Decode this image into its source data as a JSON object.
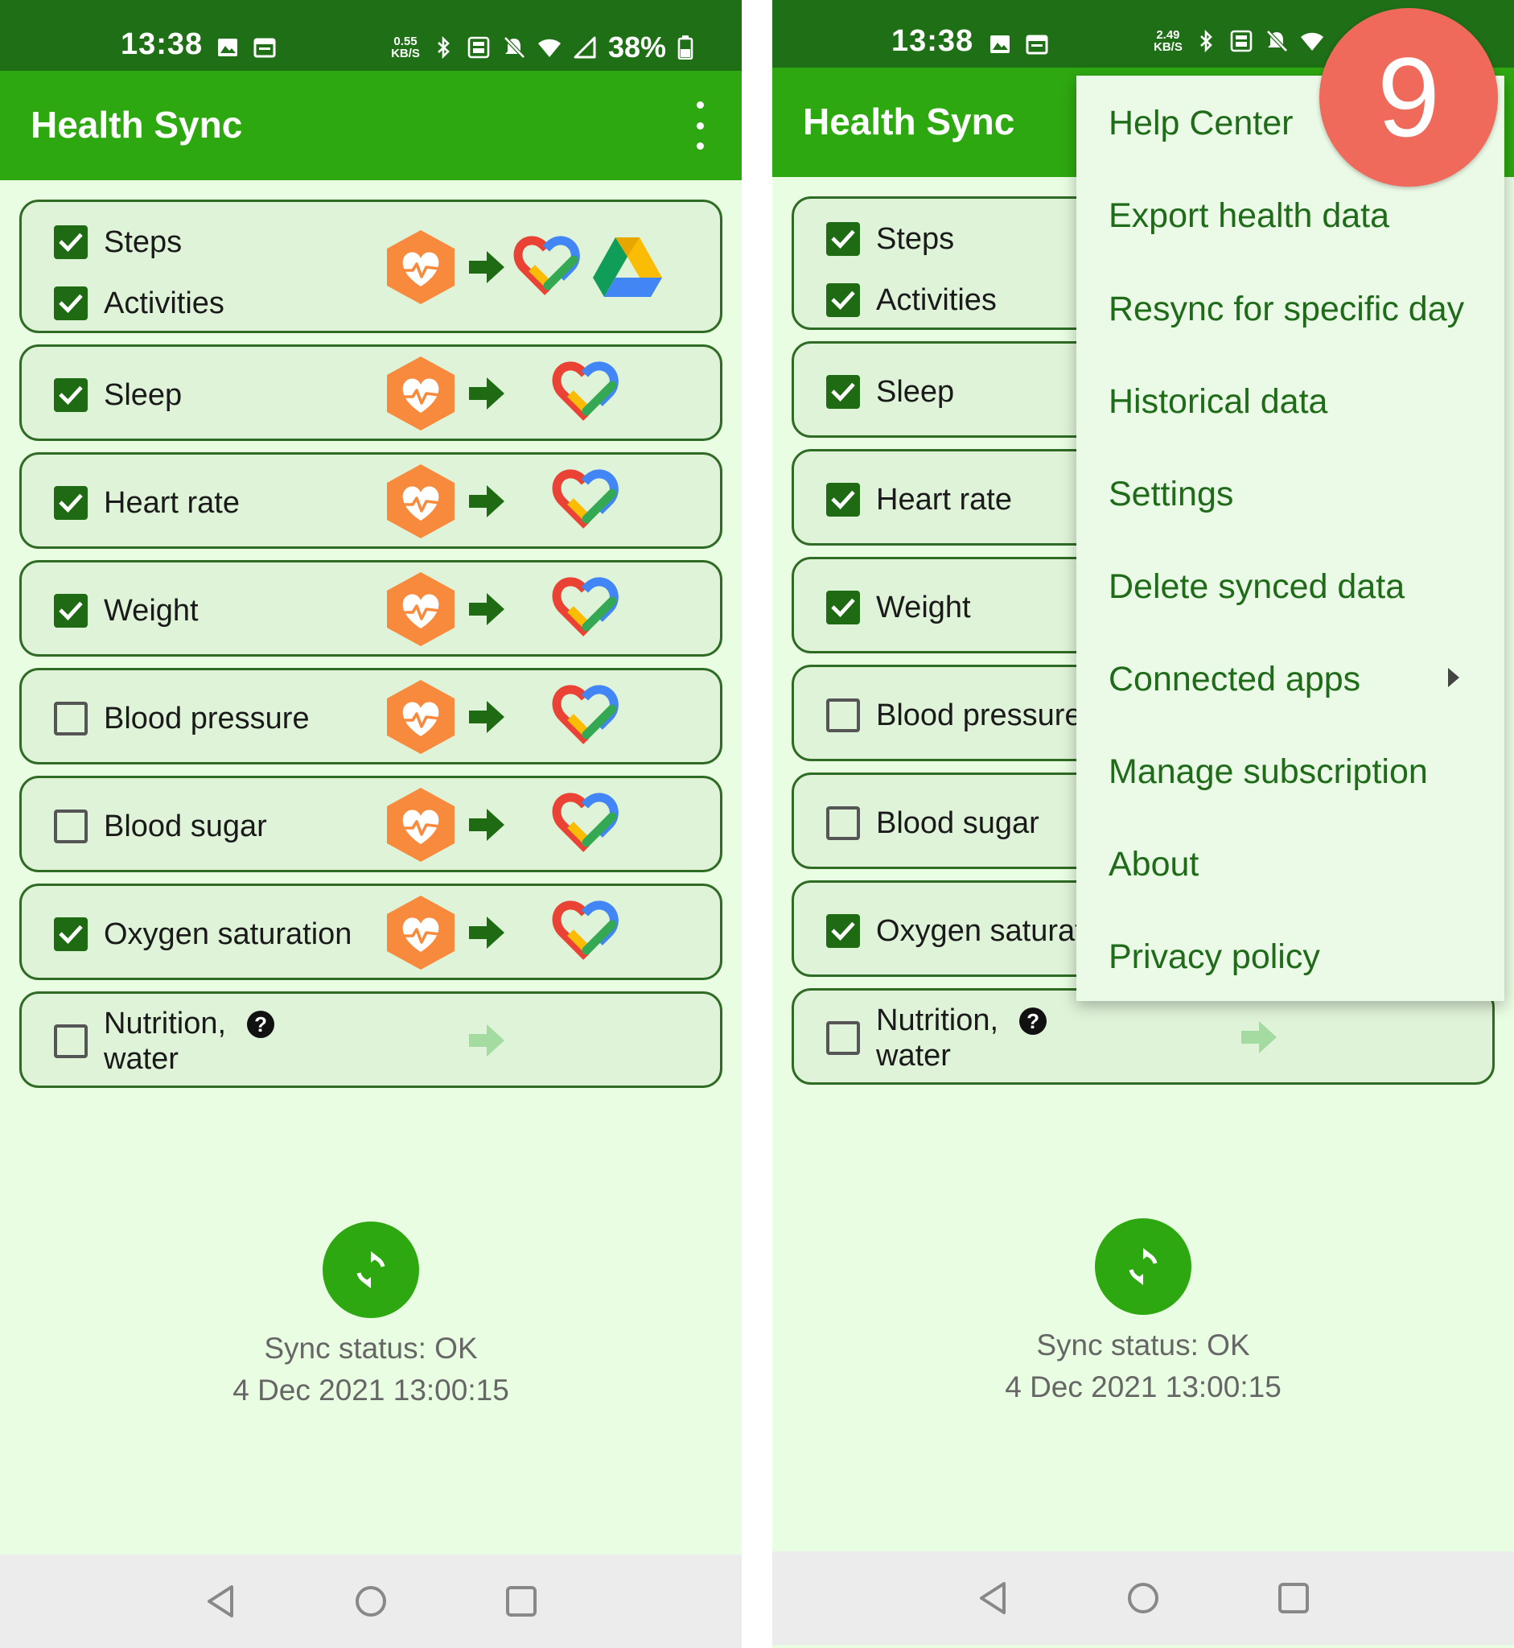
{
  "status_bar": {
    "time": "13:38",
    "left_netspeed_value": "0.55",
    "right_netspeed_value": "2.49",
    "netspeed_unit": "KB/S",
    "battery": "38%",
    "icons": [
      "image-icon",
      "calendar-icon",
      "bluetooth-icon",
      "volte-icon",
      "mute-icon",
      "wifi-icon",
      "signal-icon",
      "battery-icon"
    ]
  },
  "app": {
    "title": "Health Sync"
  },
  "rows": [
    {
      "labels": [
        "Steps",
        "Activities"
      ],
      "checked": [
        true,
        true
      ],
      "destinations": [
        "google-fit",
        "google-drive"
      ]
    },
    {
      "labels": [
        "Sleep"
      ],
      "checked": [
        true
      ],
      "destinations": [
        "google-fit"
      ]
    },
    {
      "labels": [
        "Heart rate"
      ],
      "checked": [
        true
      ],
      "destinations": [
        "google-fit"
      ]
    },
    {
      "labels": [
        "Weight"
      ],
      "checked": [
        true
      ],
      "destinations": [
        "google-fit"
      ]
    },
    {
      "labels": [
        "Blood pressure"
      ],
      "checked": [
        false
      ],
      "destinations": [
        "google-fit"
      ]
    },
    {
      "labels": [
        "Blood sugar"
      ],
      "checked": [
        false
      ],
      "destinations": [
        "google-fit"
      ]
    },
    {
      "labels": [
        "Oxygen saturation"
      ],
      "checked": [
        true
      ],
      "destinations": [
        "google-fit"
      ]
    },
    {
      "labels": [
        "Nutrition, water"
      ],
      "label_lines": [
        "Nutrition,",
        "water"
      ],
      "checked": [
        false
      ],
      "destinations": []
    }
  ],
  "right_rows_truncated": {
    "blood_pressure": "Blood pressure",
    "oxygen": "Oxygen saturat"
  },
  "sync": {
    "status": "Sync status: OK",
    "timestamp": "4 Dec 2021 13:00:15"
  },
  "menu": {
    "items": [
      "Help Center",
      "Export health data",
      "Resync for specific day",
      "Historical data",
      "Settings",
      "Delete synced data",
      "Connected apps",
      "Manage subscription",
      "About",
      "Privacy policy"
    ]
  },
  "badge": {
    "number": "9",
    "color": "#ef6a5b"
  },
  "colors": {
    "status_bar": "#1f6f16",
    "app_bar": "#2ea811",
    "background": "#e9fde3",
    "row_fill": "#dff3d8",
    "checkbox": "#1e6b14",
    "menu_text": "#1f6b1a"
  }
}
